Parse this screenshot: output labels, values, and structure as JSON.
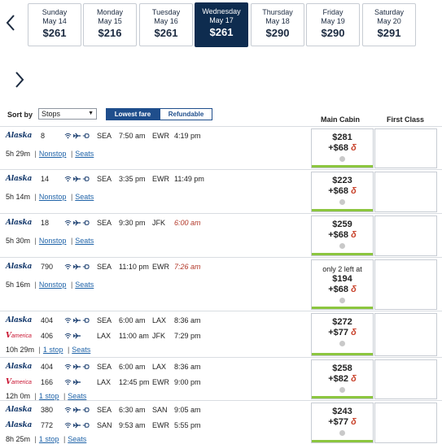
{
  "dates": [
    {
      "day": "Sunday",
      "date": "May 14",
      "price": "$261",
      "selected": false
    },
    {
      "day": "Monday",
      "date": "May 15",
      "price": "$216",
      "selected": false
    },
    {
      "day": "Tuesday",
      "date": "May 16",
      "price": "$261",
      "selected": false
    },
    {
      "day": "Wednesday",
      "date": "May 17",
      "price": "$261",
      "selected": true
    },
    {
      "day": "Thursday",
      "date": "May 18",
      "price": "$290",
      "selected": false
    },
    {
      "day": "Friday",
      "date": "May 19",
      "price": "$290",
      "selected": false
    },
    {
      "day": "Saturday",
      "date": "May 20",
      "price": "$291",
      "selected": false
    }
  ],
  "controls": {
    "sort_label": "Sort by",
    "sort_value": "Stops",
    "toggle_lowest": "Lowest fare",
    "toggle_refundable": "Refundable"
  },
  "columns": {
    "main": "Main Cabin",
    "first": "First Class"
  },
  "airlines": {
    "alaska": "Alaska",
    "virgin": "america"
  },
  "links": {
    "seats": "Seats"
  },
  "miles_tag": "δ",
  "flights": [
    {
      "segments": [
        {
          "airline": "alaska",
          "flight": "8",
          "from": "SEA",
          "dep": "7:50 am",
          "to": "EWR",
          "arr": "4:19 pm",
          "next_day": false
        }
      ],
      "duration": "5h 29m",
      "stops": "Nonstop",
      "note": "",
      "price": "$281",
      "miles": "+$68"
    },
    {
      "segments": [
        {
          "airline": "alaska",
          "flight": "14",
          "from": "SEA",
          "dep": "3:35 pm",
          "to": "EWR",
          "arr": "11:49 pm",
          "next_day": false
        }
      ],
      "duration": "5h 14m",
      "stops": "Nonstop",
      "note": "",
      "price": "$223",
      "miles": "+$68"
    },
    {
      "segments": [
        {
          "airline": "alaska",
          "flight": "18",
          "from": "SEA",
          "dep": "9:30 pm",
          "to": "JFK",
          "arr": "6:00 am",
          "next_day": true
        }
      ],
      "duration": "5h 30m",
      "stops": "Nonstop",
      "note": "",
      "price": "$259",
      "miles": "+$68"
    },
    {
      "segments": [
        {
          "airline": "alaska",
          "flight": "790",
          "from": "SEA",
          "dep": "11:10 pm",
          "to": "EWR",
          "arr": "7:26 am",
          "next_day": true
        }
      ],
      "duration": "5h 16m",
      "stops": "Nonstop",
      "note": "only 2 left at",
      "price": "$194",
      "miles": "+$68"
    },
    {
      "segments": [
        {
          "airline": "alaska",
          "flight": "404",
          "from": "SEA",
          "dep": "6:00 am",
          "to": "LAX",
          "arr": "8:36 am",
          "next_day": false
        },
        {
          "airline": "virgin",
          "flight": "406",
          "from": "LAX",
          "dep": "11:00 am",
          "to": "JFK",
          "arr": "7:29 pm",
          "next_day": false
        }
      ],
      "duration": "10h 29m",
      "stops": "1 stop",
      "note": "",
      "price": "$272",
      "miles": "+$77"
    },
    {
      "segments": [
        {
          "airline": "alaska",
          "flight": "404",
          "from": "SEA",
          "dep": "6:00 am",
          "to": "LAX",
          "arr": "8:36 am",
          "next_day": false
        },
        {
          "airline": "virgin",
          "flight": "166",
          "from": "LAX",
          "dep": "12:45 pm",
          "to": "EWR",
          "arr": "9:00 pm",
          "next_day": false
        }
      ],
      "duration": "12h 0m",
      "stops": "1 stop",
      "note": "",
      "price": "$258",
      "miles": "+$82"
    },
    {
      "segments": [
        {
          "airline": "alaska",
          "flight": "380",
          "from": "SEA",
          "dep": "6:30 am",
          "to": "SAN",
          "arr": "9:05 am",
          "next_day": false
        },
        {
          "airline": "alaska",
          "flight": "772",
          "from": "SAN",
          "dep": "9:53 am",
          "to": "EWR",
          "arr": "5:55 pm",
          "next_day": false
        }
      ],
      "duration": "8h 25m",
      "stops": "1 stop",
      "note": "",
      "price": "$243",
      "miles": "+$77"
    }
  ]
}
